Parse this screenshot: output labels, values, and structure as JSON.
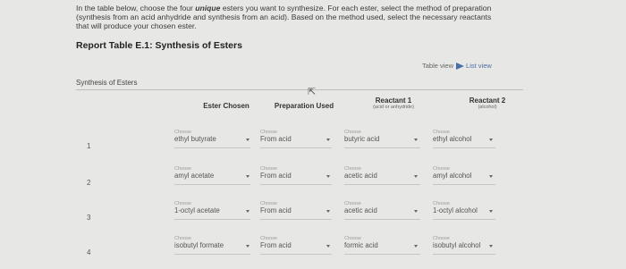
{
  "instructions": {
    "before": "In the table below, choose the four ",
    "emphasis": "unique",
    "after": " esters you want to synthesize. For each ester, select the method of preparation (synthesis from an acid anhydride and synthesis from an acid). Based on the method used, select the necessary reactants that will produce your chosen ester."
  },
  "report_title": "Report Table E.1: Synthesis of Esters",
  "view_toggle": {
    "table_view": "Table view",
    "list_view": "List view"
  },
  "table": {
    "label": "Synthesis of Esters",
    "headers": {
      "ester": "Ester Chosen",
      "preparation": "Preparation Used",
      "reactant1": "Reactant 1",
      "reactant1_sub": "(acid or anhydride)",
      "reactant2": "Reactant 2",
      "reactant2_sub": "(alcohol)"
    },
    "choose_label": "Choose",
    "rows": [
      {
        "num": "1",
        "ester": "ethyl butyrate",
        "preparation": "From acid",
        "reactant1": "butyric acid",
        "reactant2": "ethyl alcohol"
      },
      {
        "num": "2",
        "ester": "amyl acetate",
        "preparation": "From acid",
        "reactant1": "acetic acid",
        "reactant2": "amyl alcohol"
      },
      {
        "num": "3",
        "ester": "1-octyl acetate",
        "preparation": "From acid",
        "reactant1": "acetic acid",
        "reactant2": "1-octyl alcohol"
      },
      {
        "num": "4",
        "ester": "isobutyl formate",
        "preparation": "From acid",
        "reactant1": "formic acid",
        "reactant2": "isobutyl alcohol"
      }
    ]
  }
}
